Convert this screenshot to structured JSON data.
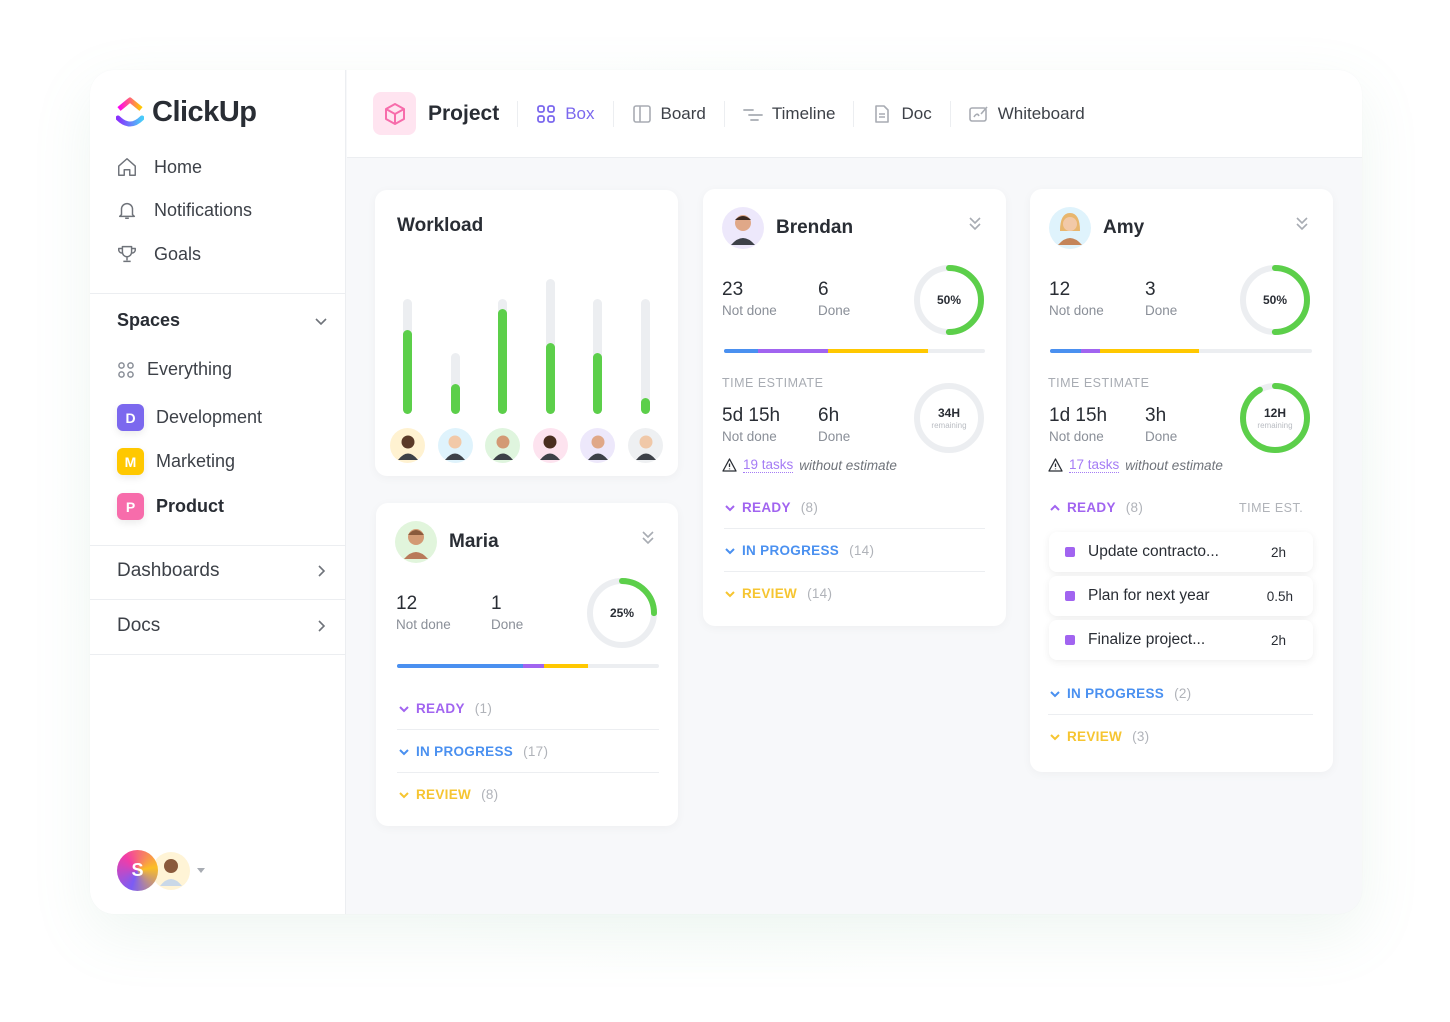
{
  "app": {
    "name": "ClickUp"
  },
  "sidebar": {
    "nav": [
      {
        "label": "Home",
        "icon": "home-icon"
      },
      {
        "label": "Notifications",
        "icon": "bell-icon"
      },
      {
        "label": "Goals",
        "icon": "trophy-icon"
      }
    ],
    "spaces_label": "Spaces",
    "spaces": [
      {
        "label": "Everything",
        "badge": "",
        "color": ""
      },
      {
        "label": "Development",
        "badge": "D",
        "color": "#7b68ee"
      },
      {
        "label": "Marketing",
        "badge": "M",
        "color": "#ffc800"
      },
      {
        "label": "Product",
        "badge": "P",
        "color": "#f76cab"
      }
    ],
    "dashboards_label": "Dashboards",
    "docs_label": "Docs",
    "user_initial": "S"
  },
  "topbar": {
    "project_title": "Project",
    "tabs": [
      {
        "label": "Box",
        "active": true
      },
      {
        "label": "Board",
        "active": false
      },
      {
        "label": "Timeline",
        "active": false
      },
      {
        "label": "Doc",
        "active": false
      },
      {
        "label": "Whiteboard",
        "active": false
      }
    ]
  },
  "colors": {
    "green": "#5ccf4a",
    "purple": "#a164f0",
    "blue": "#4a90f0",
    "yellow": "#ffc800",
    "accent": "#7b68ee"
  },
  "workload": {
    "title": "Workload",
    "bars": [
      {
        "capacity": 0.81,
        "load": 0.59,
        "avatar_bg": "#fff2d1"
      },
      {
        "capacity": 0.43,
        "load": 0.21,
        "avatar_bg": "#dff3fc"
      },
      {
        "capacity": 0.81,
        "load": 0.74,
        "avatar_bg": "#dff5de"
      },
      {
        "capacity": 0.95,
        "load": 0.5,
        "avatar_bg": "#fde3ef"
      },
      {
        "capacity": 0.81,
        "load": 0.43,
        "avatar_bg": "#ede8fb"
      },
      {
        "capacity": 0.81,
        "load": 0.11,
        "avatar_bg": "#eef0f2"
      }
    ]
  },
  "people": {
    "brendan": {
      "name": "Brendan",
      "not_done": "23",
      "not_done_label": "Not done",
      "done": "6",
      "done_label": "Done",
      "percent": 50,
      "percent_label": "50%",
      "progress": {
        "blue": 0.13,
        "purple": 0.27,
        "yellow": 0.38
      },
      "time_estimate_label": "TIME ESTIMATE",
      "te_not_done": "5d 15h",
      "te_done": "6h",
      "remaining_value": "34H",
      "remaining_label": "remaining",
      "remaining_fraction": 0,
      "warn_link": "19 tasks",
      "warn_rest": "without estimate",
      "groups": [
        {
          "label": "READY",
          "count": "(8)",
          "color": "#a164f0"
        },
        {
          "label": "IN PROGRESS",
          "count": "(14)",
          "color": "#4a90f0"
        },
        {
          "label": "REVIEW",
          "count": "(14)",
          "color": "#f6c531"
        }
      ]
    },
    "maria": {
      "name": "Maria",
      "not_done": "12",
      "not_done_label": "Not done",
      "done": "1",
      "done_label": "Done",
      "percent": 25,
      "percent_label": "25%",
      "progress": {
        "blue": 0.48,
        "purple": 0.08,
        "yellow": 0.17
      },
      "groups": [
        {
          "label": "READY",
          "count": "(1)",
          "color": "#a164f0"
        },
        {
          "label": "IN PROGRESS",
          "count": "(17)",
          "color": "#4a90f0"
        },
        {
          "label": "REVIEW",
          "count": "(8)",
          "color": "#f6c531"
        }
      ]
    },
    "amy": {
      "name": "Amy",
      "not_done": "12",
      "not_done_label": "Not done",
      "done": "3",
      "done_label": "Done",
      "percent": 50,
      "percent_label": "50%",
      "progress": {
        "blue": 0.12,
        "purple": 0.07,
        "yellow": 0.38
      },
      "time_estimate_label": "TIME ESTIMATE",
      "te_not_done": "1d 15h",
      "te_done": "3h",
      "remaining_value": "12H",
      "remaining_label": "remaining",
      "remaining_fraction": 0.92,
      "warn_link": "17 tasks",
      "warn_rest": "without estimate",
      "time_est_header": "TIME EST.",
      "ready": {
        "label": "READY",
        "count": "(8)",
        "color": "#a164f0"
      },
      "tasks": [
        {
          "name": "Update contracto...",
          "estimate": "2h"
        },
        {
          "name": "Plan for next year",
          "estimate": "0.5h"
        },
        {
          "name": "Finalize project...",
          "estimate": "2h"
        }
      ],
      "groups": [
        {
          "label": "IN PROGRESS",
          "count": "(2)",
          "color": "#4a90f0"
        },
        {
          "label": "REVIEW",
          "count": "(3)",
          "color": "#f6c531"
        }
      ]
    }
  }
}
